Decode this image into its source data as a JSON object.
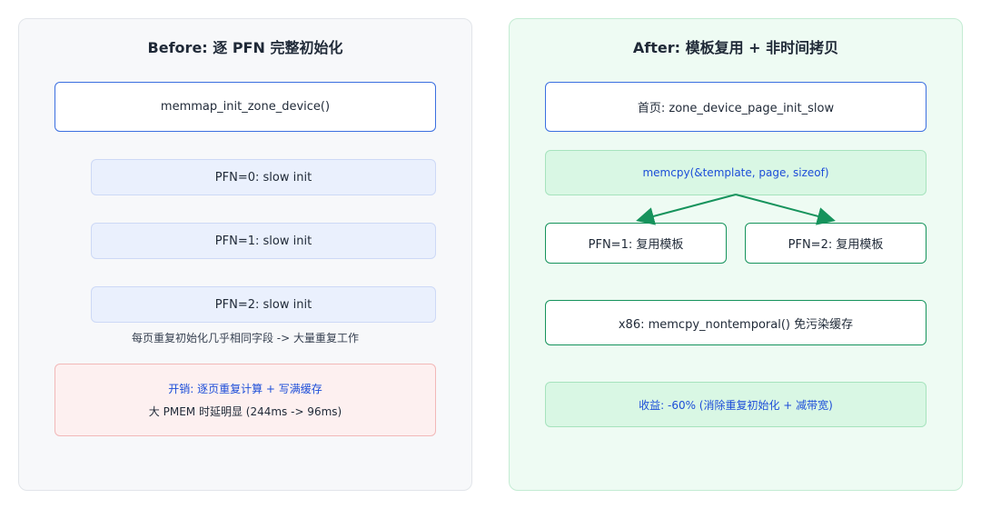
{
  "before": {
    "title": "Before: 逐 PFN 完整初始化",
    "entry": "memmap_init_zone_device()",
    "steps": [
      "PFN=0: slow init",
      "PFN=1: slow init",
      "PFN=2: slow init"
    ],
    "note": "每页重复初始化几乎相同字段 -> 大量重复工作",
    "cost": {
      "line1": "开销: 逐页重复计算 + 写满缓存",
      "line2": "大 PMEM 时延明显 (244ms -> 96ms)"
    }
  },
  "after": {
    "title": "After: 模板复用 + 非时间拷贝",
    "first": "首页: zone_device_page_init_slow",
    "memcpy": "memcpy(&template, page, sizeof)",
    "reuse": [
      "PFN=1: 复用模板",
      "PFN=2: 复用模板"
    ],
    "x86": "x86: memcpy_nontemporal() 免污染缓存",
    "gain": "收益: -60% (消除重复初始化 + 减带宽)"
  },
  "colors": {
    "accent_blue": "#3b6fe0",
    "accent_green": "#16935c",
    "text_blue": "#1d4ed8",
    "cost_border": "#f2b8b8"
  }
}
